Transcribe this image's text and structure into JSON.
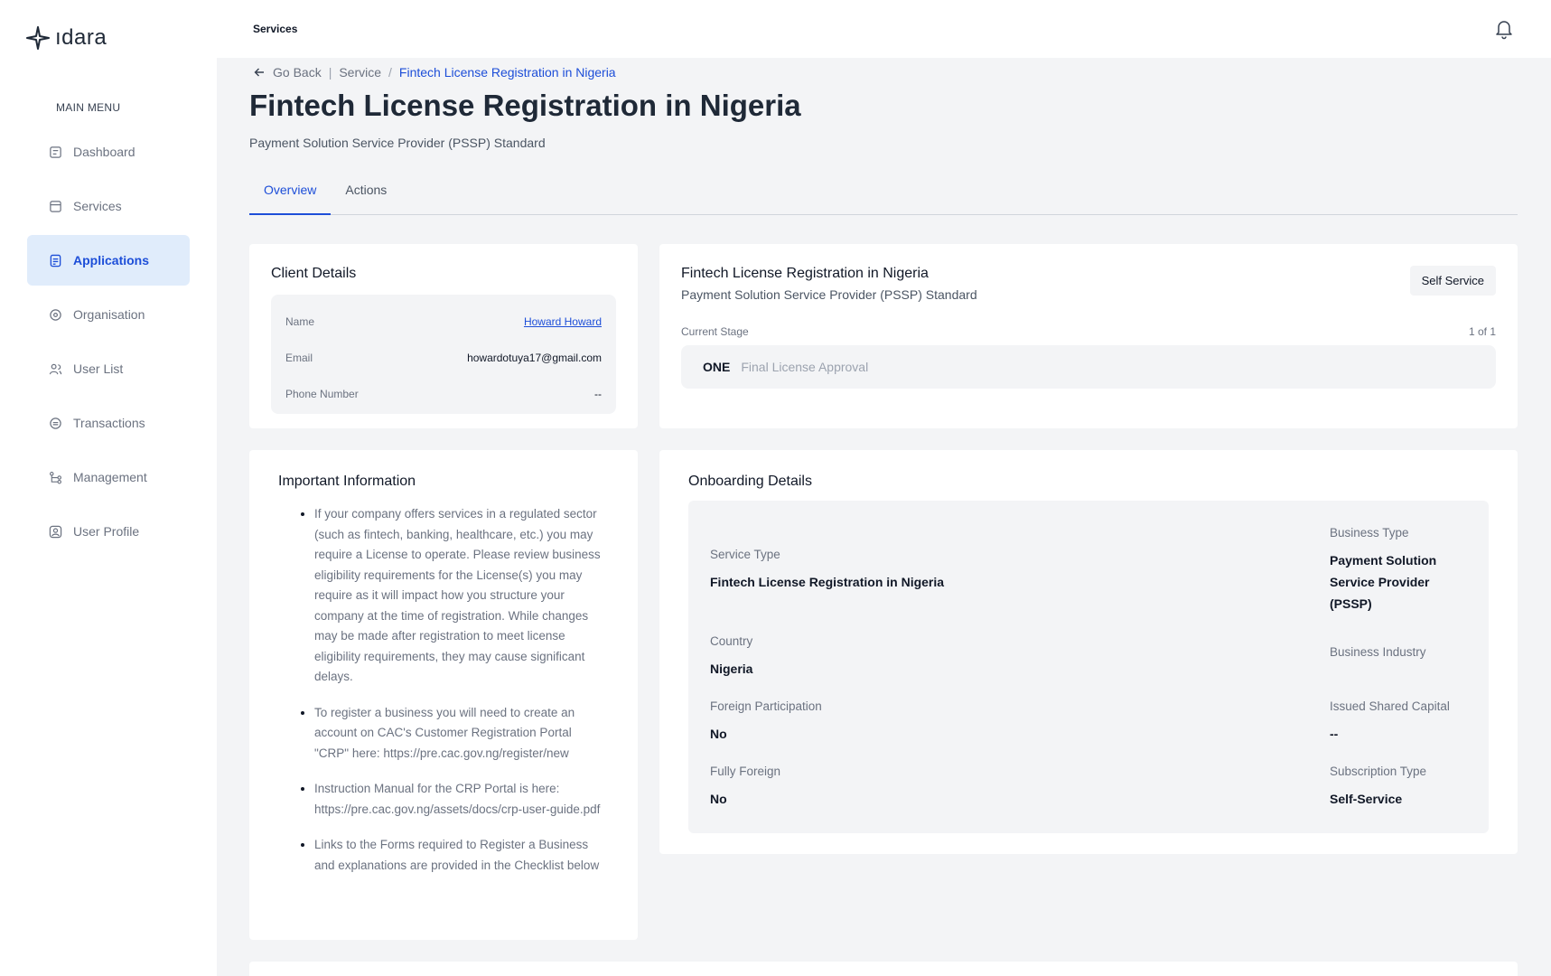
{
  "app": {
    "logo_text": "ıdara"
  },
  "sidebar": {
    "heading": "MAIN MENU",
    "items": [
      {
        "label": "Dashboard",
        "icon": "dashboard-icon"
      },
      {
        "label": "Services",
        "icon": "services-icon"
      },
      {
        "label": "Applications",
        "icon": "applications-icon",
        "active": true
      },
      {
        "label": "Organisation",
        "icon": "organisation-icon"
      },
      {
        "label": "User List",
        "icon": "users-icon"
      },
      {
        "label": "Transactions",
        "icon": "transactions-icon"
      },
      {
        "label": "Management",
        "icon": "management-icon"
      },
      {
        "label": "User Profile",
        "icon": "user-profile-icon"
      }
    ]
  },
  "topbar": {
    "title": "Services"
  },
  "breadcrumb": {
    "back": "Go Back",
    "service": "Service",
    "current": "Fintech License Registration in Nigeria"
  },
  "page": {
    "title": "Fintech License Registration in Nigeria",
    "subtitle": "Payment Solution Service Provider (PSSP) Standard"
  },
  "tabs": [
    "Overview",
    "Actions"
  ],
  "client": {
    "title": "Client Details",
    "name_label": "Name",
    "name_value": "Howard Howard",
    "email_label": "Email",
    "email_value": "howardotuya17@gmail.com",
    "phone_label": "Phone Number",
    "phone_value": "--"
  },
  "stage": {
    "title": "Fintech License Registration in Nigeria",
    "subtitle": "Payment Solution Service Provider (PSSP) Standard",
    "badge": "Self Service",
    "current_label": "Current Stage",
    "count": "1 of 1",
    "number": "ONE",
    "name": "Final License Approval"
  },
  "info": {
    "title": "Important Information",
    "items": [
      "If your company offers services in a regulated sector (such as fintech, banking, healthcare, etc.) you may require a License to operate. Please review business eligibility requirements for the License(s) you may require as it will impact how you structure your company at the time of registration. While changes may be made after registration to meet license eligibility requirements, they may cause significant delays.",
      "To register a business you will need to create an account on CAC's Customer Registration Portal \"CRP\" here: https://pre.cac.gov.ng/register/new",
      "Instruction Manual for the CRP Portal is here: https://pre.cac.gov.ng/assets/docs/crp-user-guide.pdf",
      "Links to the Forms required to Register a Business and explanations are provided in the Checklist below"
    ]
  },
  "onboarding": {
    "title": "Onboarding Details",
    "service_type_label": "Service Type",
    "service_type_value": "Fintech License Registration in Nigeria",
    "business_type_label": "Business Type",
    "business_type_value": "Payment Solution Service Provider (PSSP)",
    "country_label": "Country",
    "country_value": "Nigeria",
    "business_industry_label": "Business Industry",
    "foreign_label": "Foreign Participation",
    "foreign_value": "No",
    "capital_label": "Issued Shared Capital",
    "capital_value": "--",
    "fully_foreign_label": "Fully Foreign",
    "fully_foreign_value": "No",
    "subscription_label": "Subscription Type",
    "subscription_value": "Self-Service"
  }
}
